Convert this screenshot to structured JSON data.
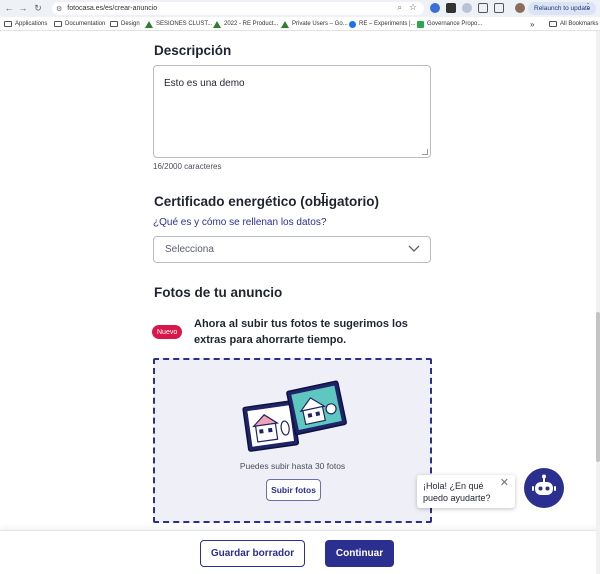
{
  "browser": {
    "url": "fotocasa.es/es/crear-anuncio",
    "relaunch_label": "Relaunch to update",
    "bookmarks": [
      {
        "label": "Applications",
        "icon": "folder-icon"
      },
      {
        "label": "Documentation",
        "icon": "folder-icon"
      },
      {
        "label": "Design",
        "icon": "folder-icon"
      },
      {
        "label": "SESIONES CLUST...",
        "icon": "drive-icon"
      },
      {
        "label": "2022 - RE Product...",
        "icon": "drive-icon"
      },
      {
        "label": "Private Users – Go...",
        "icon": "drive-icon"
      },
      {
        "label": "RE – Experiments |...",
        "icon": "globe-icon"
      },
      {
        "label": "Governance Propo...",
        "icon": "doc-icon"
      }
    ],
    "more_label": "»",
    "all_bookmarks_label": "All Bookmarks"
  },
  "description": {
    "heading": "Descripción",
    "value": "Esto es una demo",
    "counter": "16/2000 caracteres"
  },
  "certificate": {
    "heading": "Certificado energético (obligatorio)",
    "help_link": "¿Qué es y cómo se rellenan los datos?",
    "select_value": "Selecciona"
  },
  "photos": {
    "heading": "Fotos de tu anuncio",
    "badge": "Nuevo",
    "promo_text": "Ahora al subir tus fotos te sugerimos los extras para ahorrarte tiempo.",
    "upload_hint": "Puedes subir hasta 30 fotos",
    "upload_button": "Subir fotos"
  },
  "chat": {
    "bubble_text": "¡Hola! ¿En qué puedo ayudarte?",
    "close_label": "✕"
  },
  "footer": {
    "save_draft": "Guardar borrador",
    "continue": "Continuar"
  },
  "colors": {
    "brand": "#2b2f8f",
    "badge": "#d9184a",
    "dropzone_bg": "#efeff7"
  }
}
